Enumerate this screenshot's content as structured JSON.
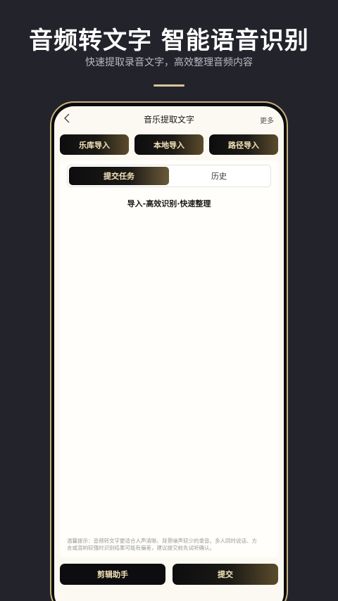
{
  "promo": {
    "headline": "音频转文字 智能语音识别",
    "subline": "快速提取录音文字，高效整理音频内容"
  },
  "nav": {
    "back_icon": "chevron-left-icon",
    "title": "音乐提取文字",
    "more": "更多"
  },
  "import_buttons": [
    {
      "label": "乐库导入"
    },
    {
      "label": "本地导入"
    },
    {
      "label": "路径导入"
    }
  ],
  "tabs": [
    {
      "label": "提交任务",
      "active": true
    },
    {
      "label": "历史",
      "active": false
    }
  ],
  "tagline": "导入-高效识别·快速整理",
  "tip": "温馨提示：音频转文字更适合人声清晰、背景噪声较少的录音。多人同时说话、方言或混响较强时识别结果可能有偏差，建议提交前先试听确认。",
  "bottom_buttons": {
    "assistant": "剪辑助手",
    "submit": "提交"
  },
  "colors": {
    "background": "#23232b",
    "accent_gold": "#d9c79a",
    "button_text": "#f3e3b8",
    "screen_bg": "#fbf9f1"
  }
}
